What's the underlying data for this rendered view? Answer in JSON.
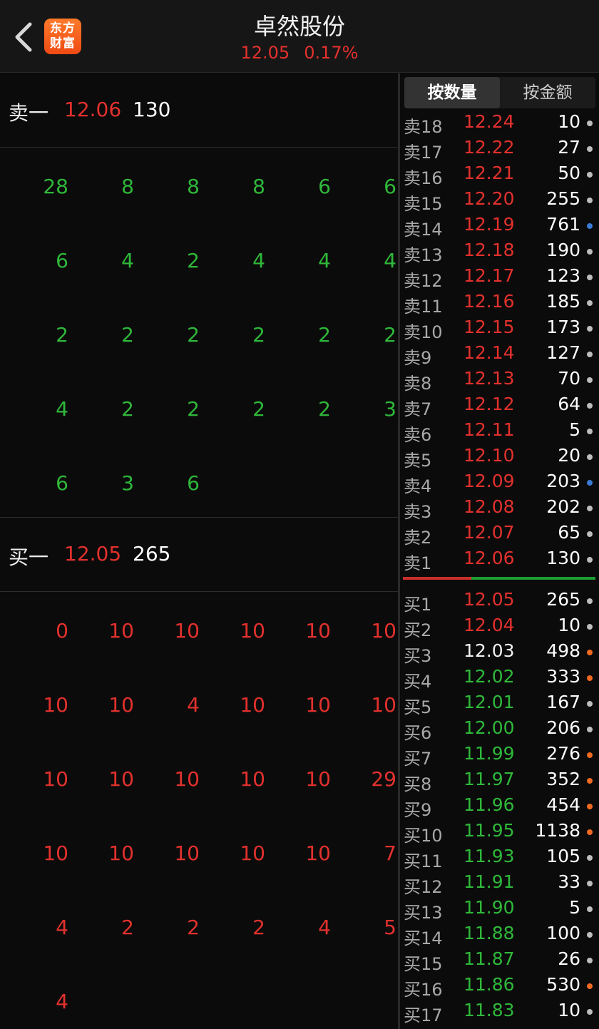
{
  "header": {
    "title": "卓然股份",
    "price": "12.05",
    "change_pct": "0.17%",
    "logo_line1": "东方",
    "logo_line2": "财富"
  },
  "colors": {
    "up": "#e2312d",
    "down": "#2fb83a",
    "neutral": "#f0f0f0",
    "dot_gray": "#bdbdbd",
    "dot_blue": "#3a7bd5",
    "dot_orange": "#f06a22"
  },
  "ask1": {
    "label": "卖一",
    "price": "12.06",
    "volume": "130",
    "queue": [
      "28",
      "8",
      "8",
      "8",
      "6",
      "6",
      "6",
      "4",
      "2",
      "4",
      "4",
      "4",
      "2",
      "2",
      "2",
      "2",
      "2",
      "2",
      "4",
      "2",
      "2",
      "2",
      "2",
      "3",
      "6",
      "3",
      "6"
    ]
  },
  "bid1": {
    "label": "买一",
    "price": "12.05",
    "volume": "265",
    "queue": [
      "0",
      "10",
      "10",
      "10",
      "10",
      "10",
      "10",
      "10",
      "4",
      "10",
      "10",
      "10",
      "10",
      "10",
      "10",
      "10",
      "10",
      "29",
      "10",
      "10",
      "10",
      "10",
      "10",
      "7",
      "4",
      "2",
      "2",
      "2",
      "4",
      "5",
      "4"
    ]
  },
  "tabs": {
    "by_volume": "按数量",
    "by_amount": "按金额"
  },
  "asks": [
    {
      "label": "卖18",
      "price": "12.24",
      "volume": "10",
      "dot": "gray"
    },
    {
      "label": "卖17",
      "price": "12.22",
      "volume": "27",
      "dot": "gray"
    },
    {
      "label": "卖16",
      "price": "12.21",
      "volume": "50",
      "dot": "gray"
    },
    {
      "label": "卖15",
      "price": "12.20",
      "volume": "255",
      "dot": "gray"
    },
    {
      "label": "卖14",
      "price": "12.19",
      "volume": "761",
      "dot": "blue"
    },
    {
      "label": "卖13",
      "price": "12.18",
      "volume": "190",
      "dot": "gray"
    },
    {
      "label": "卖12",
      "price": "12.17",
      "volume": "123",
      "dot": "gray"
    },
    {
      "label": "卖11",
      "price": "12.16",
      "volume": "185",
      "dot": "gray"
    },
    {
      "label": "卖10",
      "price": "12.15",
      "volume": "173",
      "dot": "gray"
    },
    {
      "label": "卖9",
      "price": "12.14",
      "volume": "127",
      "dot": "gray"
    },
    {
      "label": "卖8",
      "price": "12.13",
      "volume": "70",
      "dot": "gray"
    },
    {
      "label": "卖7",
      "price": "12.12",
      "volume": "64",
      "dot": "gray"
    },
    {
      "label": "卖6",
      "price": "12.11",
      "volume": "5",
      "dot": "gray"
    },
    {
      "label": "卖5",
      "price": "12.10",
      "volume": "20",
      "dot": "gray"
    },
    {
      "label": "卖4",
      "price": "12.09",
      "volume": "203",
      "dot": "blue"
    },
    {
      "label": "卖3",
      "price": "12.08",
      "volume": "202",
      "dot": "gray"
    },
    {
      "label": "卖2",
      "price": "12.07",
      "volume": "65",
      "dot": "gray"
    },
    {
      "label": "卖1",
      "price": "12.06",
      "volume": "130",
      "dot": "gray"
    }
  ],
  "bids": [
    {
      "label": "买1",
      "price": "12.05",
      "volume": "265",
      "dot": "gray",
      "tone": "up"
    },
    {
      "label": "买2",
      "price": "12.04",
      "volume": "10",
      "dot": "gray",
      "tone": "up"
    },
    {
      "label": "买3",
      "price": "12.03",
      "volume": "498",
      "dot": "orange",
      "tone": "neutral"
    },
    {
      "label": "买4",
      "price": "12.02",
      "volume": "333",
      "dot": "orange",
      "tone": "down"
    },
    {
      "label": "买5",
      "price": "12.01",
      "volume": "167",
      "dot": "gray",
      "tone": "down"
    },
    {
      "label": "买6",
      "price": "12.00",
      "volume": "206",
      "dot": "gray",
      "tone": "down"
    },
    {
      "label": "买7",
      "price": "11.99",
      "volume": "276",
      "dot": "orange",
      "tone": "down"
    },
    {
      "label": "买8",
      "price": "11.97",
      "volume": "352",
      "dot": "orange",
      "tone": "down"
    },
    {
      "label": "买9",
      "price": "11.96",
      "volume": "454",
      "dot": "orange",
      "tone": "down"
    },
    {
      "label": "买10",
      "price": "11.95",
      "volume": "1138",
      "dot": "orange",
      "tone": "down"
    },
    {
      "label": "买11",
      "price": "11.93",
      "volume": "105",
      "dot": "gray",
      "tone": "down"
    },
    {
      "label": "买12",
      "price": "11.91",
      "volume": "33",
      "dot": "gray",
      "tone": "down"
    },
    {
      "label": "买13",
      "price": "11.90",
      "volume": "5",
      "dot": "gray",
      "tone": "down"
    },
    {
      "label": "买14",
      "price": "11.88",
      "volume": "100",
      "dot": "gray",
      "tone": "down"
    },
    {
      "label": "买15",
      "price": "11.87",
      "volume": "26",
      "dot": "gray",
      "tone": "down"
    },
    {
      "label": "买16",
      "price": "11.86",
      "volume": "530",
      "dot": "orange",
      "tone": "down"
    },
    {
      "label": "买17",
      "price": "11.83",
      "volume": "10",
      "dot": "gray",
      "tone": "down"
    }
  ]
}
